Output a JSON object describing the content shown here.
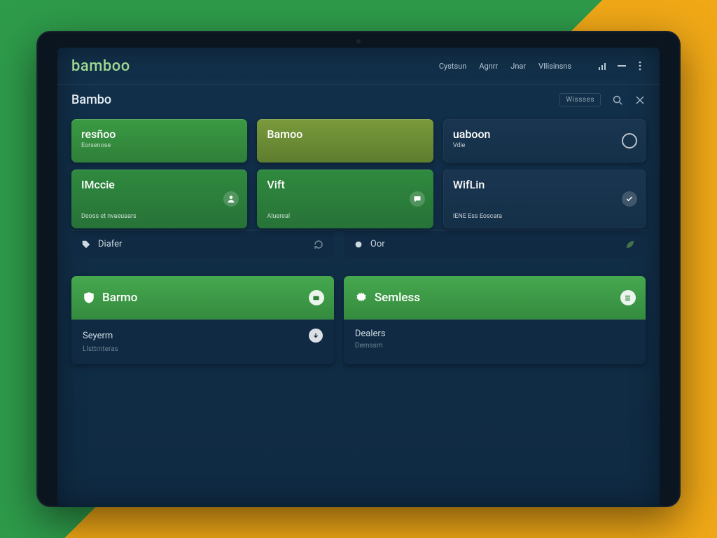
{
  "brand": "bamboo",
  "nav": {
    "a": "Cystsun",
    "b": "Agnrr",
    "c": "Jnar",
    "d": "Vllisinsns"
  },
  "subheader": {
    "title": "Bambo",
    "chip": "Wissses"
  },
  "row_a": {
    "c1": {
      "title": "resñoo",
      "sub": "Eorsenose"
    },
    "c2": {
      "title": "Bamoo",
      "sub": ""
    },
    "c3": {
      "title": "uaboon",
      "sub": "Vdie"
    }
  },
  "row_b": {
    "c1": {
      "title": "IMccie",
      "sub": "Deoss et nvaeuaars"
    },
    "c2": {
      "title": "Vift",
      "sub": "Aluereal"
    },
    "c3": {
      "title": "WifLin",
      "sub": "IENE Ess Eoscara"
    }
  },
  "slim": {
    "left": {
      "label": "Diafer"
    },
    "right": {
      "label": "Oor"
    }
  },
  "tiles": {
    "left": {
      "title": "Barmo",
      "row": "Seyerm",
      "sub": "Llsttrnteras"
    },
    "right": {
      "title": "Semless",
      "row": "Dealers",
      "sub": "Demssm"
    }
  }
}
